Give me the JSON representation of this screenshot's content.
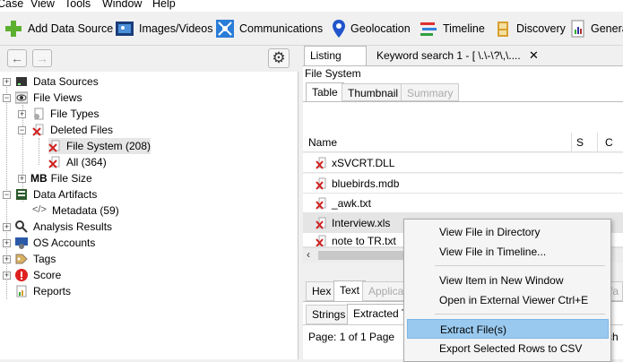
{
  "menu": [
    "Case",
    "View",
    "Tools",
    "Window",
    "Help"
  ],
  "toolbar": [
    {
      "label": "Add Data Source",
      "icon": "add-icon"
    },
    {
      "label": "Images/Videos",
      "icon": "images-icon"
    },
    {
      "label": "Communications",
      "icon": "communications-icon"
    },
    {
      "label": "Geolocation",
      "icon": "geolocation-icon"
    },
    {
      "label": "Timeline",
      "icon": "timeline-icon"
    },
    {
      "label": "Discovery",
      "icon": "discovery-icon"
    },
    {
      "label": "Genera",
      "icon": "report-icon"
    }
  ],
  "tree": {
    "data_sources": "Data Sources",
    "file_views": "File Views",
    "file_types": "File Types",
    "deleted_files": "Deleted Files",
    "file_system": "File System (208)",
    "all": "All (364)",
    "file_size_prefix": "MB",
    "file_size": "File Size",
    "data_artifacts": "Data Artifacts",
    "metadata": "Metadata (59)",
    "analysis_results": "Analysis Results",
    "os_accounts": "OS Accounts",
    "tags": "Tags",
    "score": "Score",
    "reports": "Reports"
  },
  "right": {
    "tab_listing": "Listing",
    "tab_keyword": "Keyword search 1 - [ \\.\\-\\?\\,\\....",
    "section": "File System",
    "subtab_table": "Table",
    "subtab_thumbnail": "Thumbnail",
    "subtab_summary": "Summary",
    "col_name": "Name",
    "col_s": "S",
    "col_c": "C",
    "files": [
      "xSVCRT.DLL",
      "bluebirds.mdb",
      "_awk.txt",
      "Interview.xls",
      "note to TR.txt"
    ],
    "lower_tabs": [
      "Hex",
      "Text",
      "Applica",
      "tifa"
    ],
    "lower_subtabs": [
      "Strings",
      "Extracted T"
    ],
    "page": "Page:  1  of  1   Page",
    "ch": "ch"
  },
  "context_menu": {
    "items": [
      "View File in Directory",
      "View File in Timeline...",
      "View Item in New Window",
      "Open in External Viewer  Ctrl+E",
      "Extract File(s)",
      "Export Selected Rows to CSV"
    ],
    "highlighted_index": 4
  },
  "colors": {
    "selection": "#cce8ff",
    "highlight": "#99c9ef",
    "deleted_x": "#d02020"
  }
}
